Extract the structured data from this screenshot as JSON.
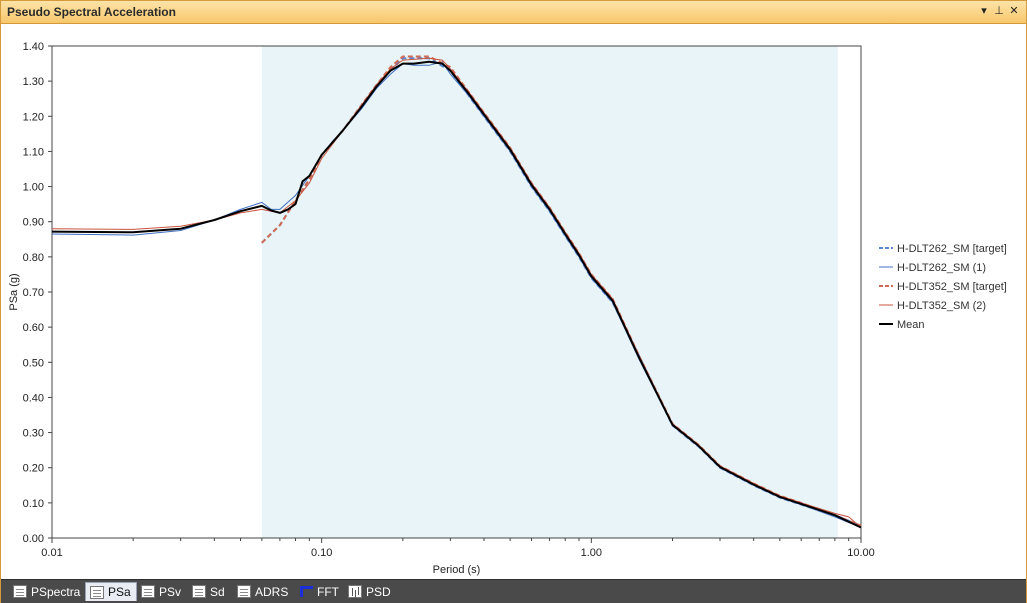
{
  "window": {
    "title": "Pseudo Spectral Acceleration",
    "pin_glyph": "▾",
    "pushpin_glyph": "⊥",
    "close_glyph": "✕"
  },
  "tabs": [
    {
      "label": "PSpectra",
      "icon": "pspectra-icon",
      "active": false
    },
    {
      "label": "PSa",
      "icon": "psa-icon",
      "active": true
    },
    {
      "label": "PSv",
      "icon": "psv-icon",
      "active": false
    },
    {
      "label": "Sd",
      "icon": "sd-icon",
      "active": false
    },
    {
      "label": "ADRS",
      "icon": "adrs-icon",
      "active": false
    },
    {
      "label": "FFT",
      "icon": "fft-icon",
      "active": false
    },
    {
      "label": "PSD",
      "icon": "psd-icon",
      "active": false
    }
  ],
  "chart_data": {
    "type": "line",
    "title": "",
    "xlabel": "Period (s)",
    "ylabel": "PSa (g)",
    "x_scale": "log",
    "xlim": [
      0.01,
      10.0
    ],
    "ylim": [
      0.0,
      1.4
    ],
    "x_ticks": [
      "0.01",
      "0.10",
      "1.00",
      "10.00"
    ],
    "y_ticks": [
      "0.00",
      "0.10",
      "0.20",
      "0.30",
      "0.40",
      "0.50",
      "0.60",
      "0.70",
      "0.80",
      "0.90",
      "1.00",
      "1.10",
      "1.20",
      "1.30",
      "1.40"
    ],
    "grid": false,
    "legend_position": "right",
    "shaded_range": {
      "x_start": 0.06,
      "x_end": 8.2,
      "color": "#e8f4f7"
    },
    "series": [
      {
        "name": "H-DLT262_SM [target]",
        "color": "#5b86d6",
        "dash": true,
        "width": 2,
        "points": [
          [
            0.06,
            0.84
          ],
          [
            0.07,
            0.89
          ],
          [
            0.08,
            0.96
          ],
          [
            0.09,
            1.02
          ],
          [
            0.1,
            1.09
          ],
          [
            0.12,
            1.16
          ],
          [
            0.14,
            1.23
          ],
          [
            0.16,
            1.29
          ],
          [
            0.18,
            1.33
          ],
          [
            0.2,
            1.365
          ],
          [
            0.25,
            1.365
          ],
          [
            0.3,
            1.33
          ],
          [
            0.35,
            1.26
          ],
          [
            0.4,
            1.2
          ],
          [
            0.5,
            1.1
          ],
          [
            0.6,
            1.0
          ],
          [
            0.7,
            0.93
          ],
          [
            0.8,
            0.86
          ],
          [
            0.9,
            0.8
          ],
          [
            1.0,
            0.74
          ],
          [
            1.2,
            0.67
          ],
          [
            1.5,
            0.52
          ],
          [
            2.0,
            0.32
          ],
          [
            2.5,
            0.26
          ],
          [
            3.0,
            0.2
          ],
          [
            4.0,
            0.15
          ],
          [
            5.0,
            0.115
          ],
          [
            6.0,
            0.095
          ],
          [
            8.0,
            0.065
          ],
          [
            10.0,
            0.035
          ]
        ]
      },
      {
        "name": "H-DLT262_SM (1)",
        "color": "#3f6fc4",
        "dash": false,
        "width": 1,
        "points": [
          [
            0.01,
            0.865
          ],
          [
            0.02,
            0.862
          ],
          [
            0.03,
            0.875
          ],
          [
            0.04,
            0.905
          ],
          [
            0.05,
            0.935
          ],
          [
            0.06,
            0.955
          ],
          [
            0.065,
            0.935
          ],
          [
            0.07,
            0.935
          ],
          [
            0.08,
            0.975
          ],
          [
            0.09,
            1.03
          ],
          [
            0.1,
            1.09
          ],
          [
            0.11,
            1.13
          ],
          [
            0.12,
            1.16
          ],
          [
            0.14,
            1.22
          ],
          [
            0.16,
            1.28
          ],
          [
            0.18,
            1.32
          ],
          [
            0.2,
            1.35
          ],
          [
            0.22,
            1.345
          ],
          [
            0.25,
            1.345
          ],
          [
            0.28,
            1.355
          ],
          [
            0.3,
            1.32
          ],
          [
            0.35,
            1.26
          ],
          [
            0.4,
            1.2
          ],
          [
            0.5,
            1.1
          ],
          [
            0.6,
            1.0
          ],
          [
            0.7,
            0.93
          ],
          [
            0.8,
            0.86
          ],
          [
            0.9,
            0.8
          ],
          [
            1.0,
            0.74
          ],
          [
            1.2,
            0.67
          ],
          [
            1.5,
            0.51
          ],
          [
            2.0,
            0.32
          ],
          [
            2.5,
            0.26
          ],
          [
            3.0,
            0.2
          ],
          [
            4.0,
            0.15
          ],
          [
            5.0,
            0.115
          ],
          [
            6.0,
            0.095
          ],
          [
            8.0,
            0.06
          ],
          [
            10.0,
            0.03
          ]
        ]
      },
      {
        "name": "H-DLT352_SM [target]",
        "color": "#d06a52",
        "dash": true,
        "width": 2,
        "points": [
          [
            0.06,
            0.84
          ],
          [
            0.07,
            0.89
          ],
          [
            0.08,
            0.96
          ],
          [
            0.09,
            1.02
          ],
          [
            0.1,
            1.09
          ],
          [
            0.12,
            1.16
          ],
          [
            0.14,
            1.23
          ],
          [
            0.16,
            1.29
          ],
          [
            0.18,
            1.34
          ],
          [
            0.2,
            1.37
          ],
          [
            0.25,
            1.37
          ],
          [
            0.3,
            1.34
          ],
          [
            0.35,
            1.27
          ],
          [
            0.4,
            1.21
          ],
          [
            0.5,
            1.11
          ],
          [
            0.6,
            1.01
          ],
          [
            0.7,
            0.94
          ],
          [
            0.8,
            0.87
          ],
          [
            0.9,
            0.81
          ],
          [
            1.0,
            0.75
          ],
          [
            1.2,
            0.68
          ],
          [
            1.5,
            0.52
          ],
          [
            2.0,
            0.325
          ],
          [
            2.5,
            0.265
          ],
          [
            3.0,
            0.205
          ],
          [
            4.0,
            0.155
          ],
          [
            5.0,
            0.12
          ],
          [
            6.0,
            0.1
          ],
          [
            8.0,
            0.065
          ],
          [
            10.0,
            0.035
          ]
        ]
      },
      {
        "name": "H-DLT352_SM (2)",
        "color": "#c9543c",
        "dash": false,
        "width": 1,
        "points": [
          [
            0.01,
            0.88
          ],
          [
            0.02,
            0.878
          ],
          [
            0.03,
            0.887
          ],
          [
            0.04,
            0.905
          ],
          [
            0.05,
            0.925
          ],
          [
            0.06,
            0.935
          ],
          [
            0.065,
            0.93
          ],
          [
            0.07,
            0.925
          ],
          [
            0.08,
            0.96
          ],
          [
            0.09,
            1.01
          ],
          [
            0.1,
            1.08
          ],
          [
            0.12,
            1.16
          ],
          [
            0.14,
            1.23
          ],
          [
            0.16,
            1.29
          ],
          [
            0.18,
            1.335
          ],
          [
            0.2,
            1.36
          ],
          [
            0.25,
            1.365
          ],
          [
            0.28,
            1.36
          ],
          [
            0.3,
            1.335
          ],
          [
            0.35,
            1.27
          ],
          [
            0.4,
            1.21
          ],
          [
            0.5,
            1.11
          ],
          [
            0.6,
            1.01
          ],
          [
            0.7,
            0.94
          ],
          [
            0.8,
            0.87
          ],
          [
            0.9,
            0.81
          ],
          [
            1.0,
            0.75
          ],
          [
            1.2,
            0.68
          ],
          [
            1.5,
            0.52
          ],
          [
            2.0,
            0.325
          ],
          [
            2.5,
            0.265
          ],
          [
            3.0,
            0.205
          ],
          [
            4.0,
            0.155
          ],
          [
            5.0,
            0.12
          ],
          [
            6.0,
            0.1
          ],
          [
            8.0,
            0.07
          ],
          [
            9.0,
            0.06
          ],
          [
            10.0,
            0.03
          ]
        ]
      },
      {
        "name": "Mean",
        "color": "#000000",
        "dash": false,
        "width": 2,
        "points": [
          [
            0.01,
            0.872
          ],
          [
            0.02,
            0.87
          ],
          [
            0.03,
            0.88
          ],
          [
            0.04,
            0.905
          ],
          [
            0.05,
            0.93
          ],
          [
            0.06,
            0.945
          ],
          [
            0.065,
            0.932
          ],
          [
            0.07,
            0.925
          ],
          [
            0.075,
            0.935
          ],
          [
            0.08,
            0.95
          ],
          [
            0.085,
            1.015
          ],
          [
            0.09,
            1.03
          ],
          [
            0.1,
            1.09
          ],
          [
            0.12,
            1.16
          ],
          [
            0.14,
            1.225
          ],
          [
            0.16,
            1.285
          ],
          [
            0.18,
            1.33
          ],
          [
            0.2,
            1.35
          ],
          [
            0.22,
            1.35
          ],
          [
            0.25,
            1.355
          ],
          [
            0.28,
            1.35
          ],
          [
            0.3,
            1.33
          ],
          [
            0.35,
            1.265
          ],
          [
            0.4,
            1.205
          ],
          [
            0.5,
            1.105
          ],
          [
            0.6,
            1.005
          ],
          [
            0.7,
            0.935
          ],
          [
            0.8,
            0.865
          ],
          [
            0.9,
            0.805
          ],
          [
            1.0,
            0.745
          ],
          [
            1.2,
            0.675
          ],
          [
            1.5,
            0.515
          ],
          [
            2.0,
            0.322
          ],
          [
            2.5,
            0.262
          ],
          [
            3.0,
            0.202
          ],
          [
            4.0,
            0.152
          ],
          [
            5.0,
            0.117
          ],
          [
            6.0,
            0.097
          ],
          [
            8.0,
            0.065
          ],
          [
            10.0,
            0.03
          ]
        ]
      }
    ]
  }
}
